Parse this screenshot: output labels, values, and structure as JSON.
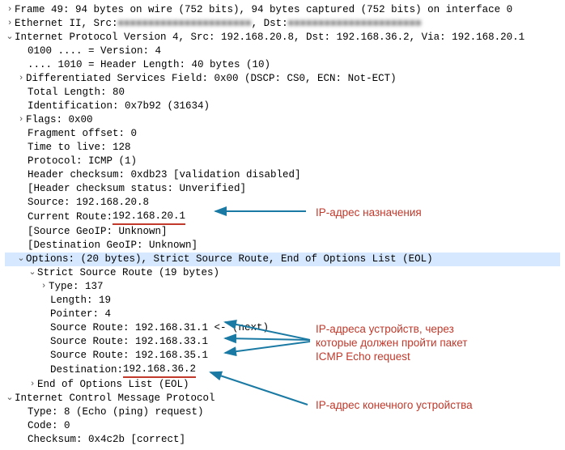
{
  "frame_summary": "Frame 49: 94 bytes on wire (752 bits), 94 bytes captured (752 bits) on interface 0",
  "eth_prefix": "Ethernet II, Src: ",
  "eth_dst_label": ", Dst: ",
  "eth_src_blur": "■■■■■■■■■■■■■■■■■■■■■■",
  "eth_dst_blur": "■■■■■■■■■■■■■■■■■■■■■■",
  "ip_header": "Internet Protocol Version 4, Src: 192.168.20.8, Dst: 192.168.36.2, Via: 192.168.20.1",
  "ip": {
    "version": "0100 .... = Version: 4",
    "hlen": ".... 1010 = Header Length: 40 bytes (10)",
    "dsf": "Differentiated Services Field: 0x00 (DSCP: CS0, ECN: Not-ECT)",
    "tlen": "Total Length: 80",
    "ident": "Identification: 0x7b92 (31634)",
    "flags": "Flags: 0x00",
    "frag": "Fragment offset: 0",
    "ttl": "Time to live: 128",
    "proto": "Protocol: ICMP (1)",
    "chksum": "Header checksum: 0xdb23 [validation disabled]",
    "chkstat": "[Header checksum status: Unverified]",
    "src": "Source: 192.168.20.8",
    "cur_route_label": "Current Route: ",
    "cur_route_val": "192.168.20.1",
    "src_geo": "[Source GeoIP: Unknown]",
    "dst_geo": "[Destination GeoIP: Unknown]",
    "options": "Options: (20 bytes), Strict Source Route, End of Options List (EOL)",
    "ssr_header": "Strict Source Route (19 bytes)",
    "ssr": {
      "type": "Type: 137",
      "length": "Length: 19",
      "pointer": "Pointer: 4",
      "sr1": "Source Route: 192.168.31.1 <- (next)",
      "sr2": "Source Route: 192.168.33.1",
      "sr3": "Source Route: 192.168.35.1",
      "dest_label": "Destination: ",
      "dest_val": "192.168.36.2"
    },
    "eol": "End of Options List (EOL)"
  },
  "icmp_header": "Internet Control Message Protocol",
  "icmp": {
    "type": "Type: 8 (Echo (ping) request)",
    "code": "Code: 0",
    "chk": "Checksum: 0x4c2b [correct]"
  },
  "ann": {
    "a1": "IP-адрес назначения",
    "a2_l1": "IP-адреса устройств, через",
    "a2_l2": "которые должен пройти пакет",
    "a2_l3": "ICMP Echo request",
    "a3": "IP-адрес конечного устройства"
  },
  "glyph": {
    "right": "›",
    "down": "⌄"
  }
}
